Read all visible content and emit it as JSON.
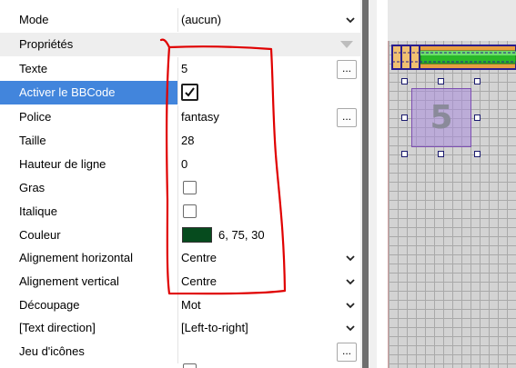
{
  "properties": {
    "mode": {
      "label": "Mode",
      "value": "(aucun)"
    },
    "section_header": "Propriétés",
    "rows": [
      {
        "label": "Texte",
        "value": "5"
      },
      {
        "label": "Activer le BBCode",
        "value": ""
      },
      {
        "label": "Police",
        "value": "fantasy"
      },
      {
        "label": "Taille",
        "value": "28"
      },
      {
        "label": "Hauteur de ligne",
        "value": "0"
      },
      {
        "label": "Gras",
        "value": ""
      },
      {
        "label": "Italique",
        "value": ""
      },
      {
        "label": "Couleur",
        "value": "6, 75, 30"
      },
      {
        "label": "Alignement horizontal",
        "value": "Centre"
      },
      {
        "label": "Alignement vertical",
        "value": "Centre"
      },
      {
        "label": "Découpage",
        "value": "Mot"
      },
      {
        "label": "[Text direction]",
        "value": "[Left-to-right]"
      },
      {
        "label": "Jeu d'icônes",
        "value": ""
      }
    ],
    "checkboxes": {
      "bbcode_checked": true,
      "bold_checked": false,
      "italic_checked": false
    },
    "color_swatch": "#064b1e",
    "selected_row": "Activer le BBCode"
  },
  "canvas": {
    "text_object_label": "5"
  },
  "colors": {
    "selection_blue": "#4285dc",
    "annotation_red": "#e00000",
    "selection_box": "#7d4fb0"
  }
}
